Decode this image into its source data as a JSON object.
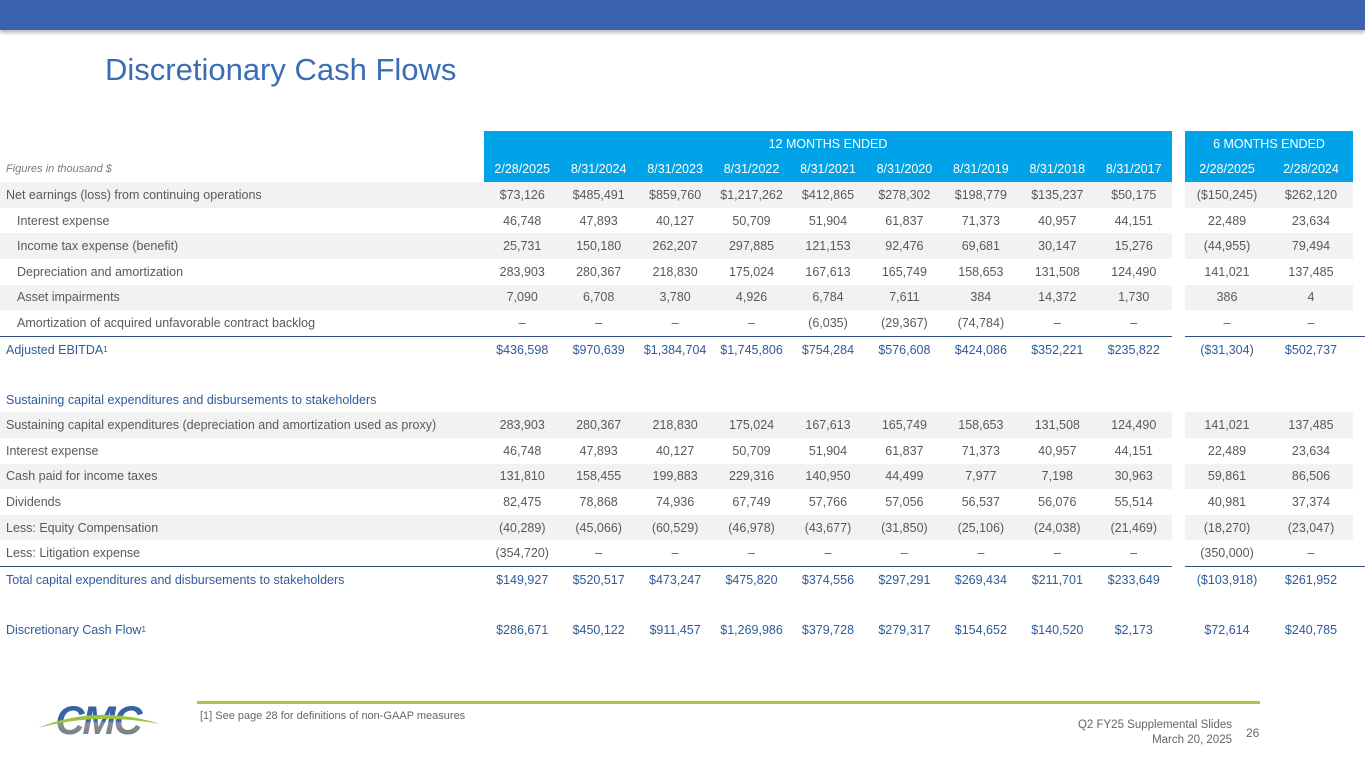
{
  "title": "Discretionary Cash Flows",
  "table": {
    "units_label": "Figures in thousand $",
    "group_12": "12 MONTHS ENDED",
    "group_6": "6 MONTHS ENDED",
    "columns": [
      "2/28/2025",
      "8/31/2024",
      "8/31/2023",
      "8/31/2022",
      "8/31/2021",
      "8/31/2020",
      "8/31/2019",
      "8/31/2018",
      "8/31/2017",
      "2/28/2025",
      "2/28/2024"
    ],
    "rows": [
      {
        "kind": "data",
        "label": "Net earnings (loss) from continuing operations",
        "values": [
          "$73,126",
          "$485,491",
          "$859,760",
          "$1,217,262",
          "$412,865",
          "$278,302",
          "$198,779",
          "$135,237",
          "$50,175",
          "($150,245)",
          "$262,120"
        ]
      },
      {
        "kind": "sub",
        "label": "Interest expense",
        "values": [
          "46,748",
          "47,893",
          "40,127",
          "50,709",
          "51,904",
          "61,837",
          "71,373",
          "40,957",
          "44,151",
          "22,489",
          "23,634"
        ]
      },
      {
        "kind": "sub",
        "label": "Income tax expense (benefit)",
        "values": [
          "25,731",
          "150,180",
          "262,207",
          "297,885",
          "121,153",
          "92,476",
          "69,681",
          "30,147",
          "15,276",
          "(44,955)",
          "79,494"
        ]
      },
      {
        "kind": "sub",
        "label": "Depreciation and amortization",
        "values": [
          "283,903",
          "280,367",
          "218,830",
          "175,024",
          "167,613",
          "165,749",
          "158,653",
          "131,508",
          "124,490",
          "141,021",
          "137,485"
        ]
      },
      {
        "kind": "sub",
        "label": "Asset impairments",
        "values": [
          "7,090",
          "6,708",
          "3,780",
          "4,926",
          "6,784",
          "7,611",
          "384",
          "14,372",
          "1,730",
          "386",
          "4"
        ]
      },
      {
        "kind": "sub",
        "label": "Amortization of acquired unfavorable contract backlog",
        "values": [
          "–",
          "–",
          "–",
          "–",
          "(6,035)",
          "(29,367)",
          "(74,784)",
          "–",
          "–",
          "–",
          "–"
        ]
      },
      {
        "kind": "total",
        "label": "Adjusted EBITDA",
        "footnote": "1",
        "values": [
          "$436,598",
          "$970,639",
          "$1,384,704",
          "$1,745,806",
          "$754,284",
          "$576,608",
          "$424,086",
          "$352,221",
          "$235,822",
          "($31,304)",
          "$502,737"
        ]
      },
      {
        "kind": "heading",
        "label": "Sustaining capital expenditures and disbursements to stakeholders",
        "values": []
      },
      {
        "kind": "data",
        "label": "Sustaining capital expenditures (depreciation and amortization used as proxy)",
        "values": [
          "283,903",
          "280,367",
          "218,830",
          "175,024",
          "167,613",
          "165,749",
          "158,653",
          "131,508",
          "124,490",
          "141,021",
          "137,485"
        ]
      },
      {
        "kind": "data",
        "label": "Interest expense",
        "values": [
          "46,748",
          "47,893",
          "40,127",
          "50,709",
          "51,904",
          "61,837",
          "71,373",
          "40,957",
          "44,151",
          "22,489",
          "23,634"
        ]
      },
      {
        "kind": "data",
        "label": "Cash paid for income taxes",
        "values": [
          "131,810",
          "158,455",
          "199,883",
          "229,316",
          "140,950",
          "44,499",
          "7,977",
          "7,198",
          "30,963",
          "59,861",
          "86,506"
        ]
      },
      {
        "kind": "data",
        "label": "Dividends",
        "values": [
          "82,475",
          "78,868",
          "74,936",
          "67,749",
          "57,766",
          "57,056",
          "56,537",
          "56,076",
          "55,514",
          "40,981",
          "37,374"
        ]
      },
      {
        "kind": "data",
        "label": "Less: Equity Compensation",
        "values": [
          "(40,289)",
          "(45,066)",
          "(60,529)",
          "(46,978)",
          "(43,677)",
          "(31,850)",
          "(25,106)",
          "(24,038)",
          "(21,469)",
          "(18,270)",
          "(23,047)"
        ]
      },
      {
        "kind": "data",
        "label": "Less: Litigation expense",
        "values": [
          "(354,720)",
          "–",
          "–",
          "–",
          "–",
          "–",
          "–",
          "–",
          "–",
          "(350,000)",
          "–"
        ]
      },
      {
        "kind": "total",
        "label": "Total capital expenditures and disbursements to stakeholders",
        "values": [
          "$149,927",
          "$520,517",
          "$473,247",
          "$475,820",
          "$374,556",
          "$297,291",
          "$269,434",
          "$211,701",
          "$233,649",
          "($103,918)",
          "$261,952"
        ]
      },
      {
        "kind": "final",
        "label": "Discretionary Cash Flow",
        "footnote": "1",
        "values": [
          "$286,671",
          "$450,122",
          "$911,457",
          "$1,269,986",
          "$379,728",
          "$279,317",
          "$154,652",
          "$140,520",
          "$2,173",
          "$72,614",
          "$240,785"
        ]
      }
    ]
  },
  "footer": {
    "footnote": "[1] See page 28 for definitions of non-GAAP measures",
    "deck": "Q2 FY25 Supplemental Slides",
    "date": "March 20, 2025",
    "page": "26",
    "logo_text": "CMC"
  },
  "colors": {
    "top_bar": "#3a62ad",
    "header": "#00a3e8",
    "accent_line": "#a9c64a",
    "title": "#3b6db5"
  }
}
